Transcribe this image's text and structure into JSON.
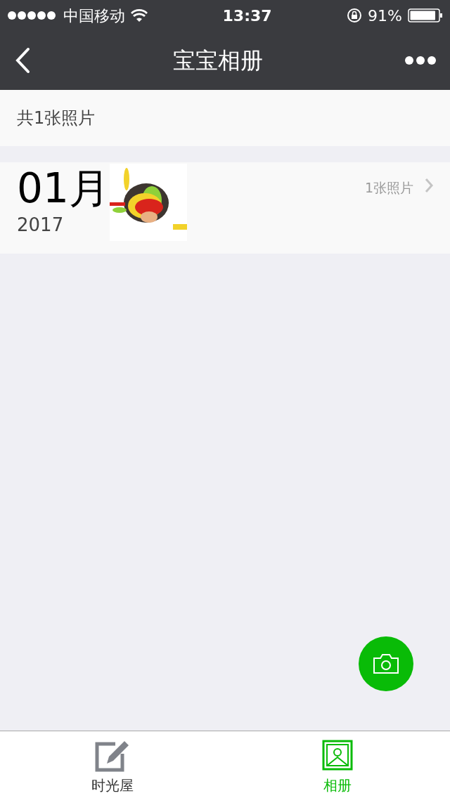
{
  "status_bar": {
    "carrier": "中国移动",
    "time": "13:37",
    "battery": "91%"
  },
  "nav": {
    "title": "宝宝相册"
  },
  "summary": "共1张照片",
  "months": [
    {
      "month": "01月",
      "year": "2017",
      "count": "1张照片"
    }
  ],
  "tabs": [
    {
      "label": "时光屋",
      "kind": "edit",
      "selected": false
    },
    {
      "label": "相册",
      "kind": "album",
      "selected": true
    }
  ]
}
